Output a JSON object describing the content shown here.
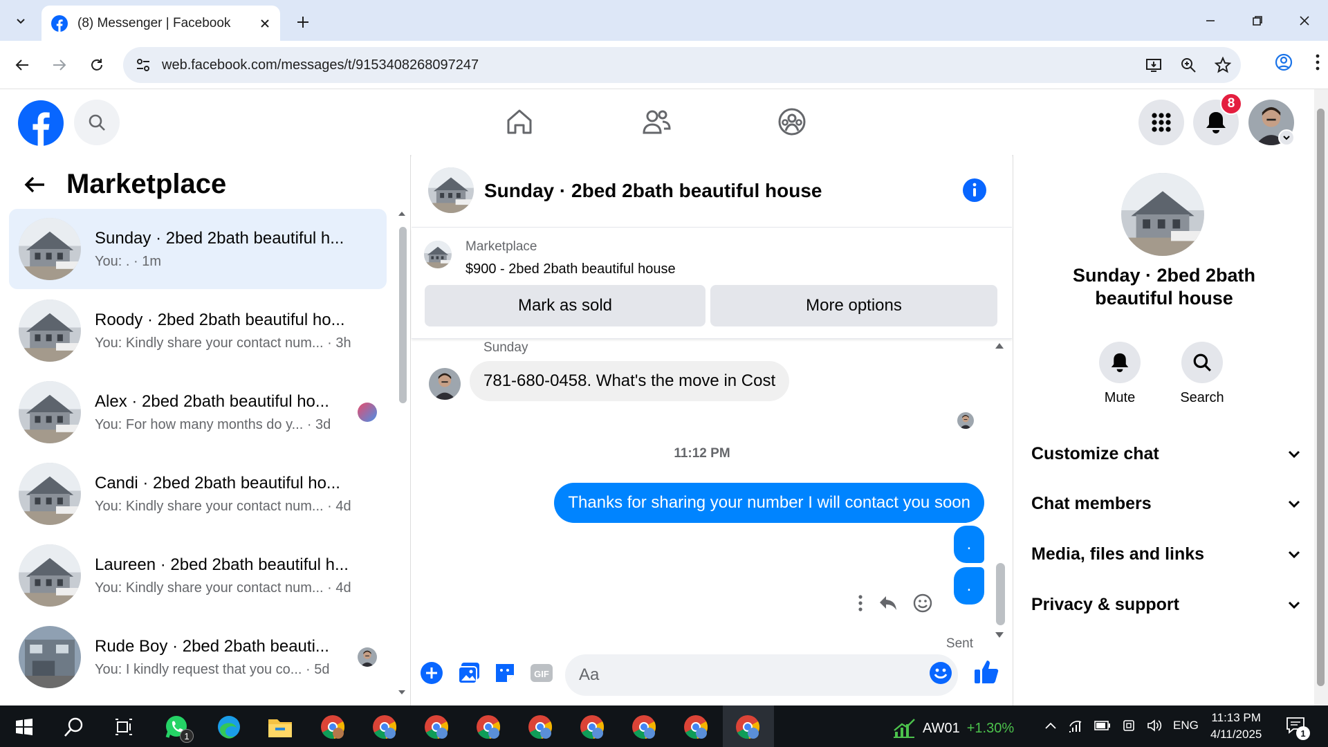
{
  "browser": {
    "tab_title": "(8) Messenger | Facebook",
    "url": "web.facebook.com/messages/t/9153408268097247"
  },
  "header": {
    "notification_count": "8"
  },
  "marketplace": {
    "title": "Marketplace",
    "conversations": [
      {
        "name": "Sunday · 2bed 2bath beautiful h...",
        "preview": "You: . · 1m",
        "active": true
      },
      {
        "name": "Roody · 2bed 2bath beautiful ho...",
        "preview": "You: Kindly share your contact num... · 3h"
      },
      {
        "name": "Alex · 2bed 2bath beautiful ho...",
        "preview": "You: For how many months do y... · 3d"
      },
      {
        "name": "Candi · 2bed 2bath beautiful ho...",
        "preview": "You: Kindly share your contact num... · 4d"
      },
      {
        "name": "Laureen · 2bed 2bath beautiful h...",
        "preview": "You: Kindly share your contact num... · 4d"
      },
      {
        "name": "Rude Boy · 2bed 2bath beauti...",
        "preview": "You: I kindly request that you co... · 5d"
      }
    ]
  },
  "chat": {
    "title": "Sunday · 2bed 2bath beautiful house",
    "listing_label": "Marketplace",
    "listing_price": "$900 - 2bed 2bath beautiful house",
    "mark_sold_label": "Mark as sold",
    "more_options_label": "More options",
    "sender_name": "Sunday",
    "incoming_message": "781-680-0458.  What's the move in Cost",
    "timestamp": "11:12 PM",
    "outgoing_message": "Thanks for sharing your number I will contact you soon",
    "outgoing_dot_1": ".",
    "outgoing_dot_2": ".",
    "sent_status": "Sent",
    "composer_placeholder": "Aa"
  },
  "details": {
    "title": "Sunday · 2bed 2bath beautiful house",
    "mute_label": "Mute",
    "search_label": "Search",
    "sections": [
      "Customize chat",
      "Chat members",
      "Media, files and links",
      "Privacy & support"
    ]
  },
  "taskbar": {
    "whatsapp_badge": "1",
    "stock_name": "AW01",
    "stock_change": "+1.30%",
    "language": "ENG",
    "time": "11:13 PM",
    "date": "4/11/2025",
    "notification_count": "1"
  },
  "colors": {
    "facebook_blue": "#0866ff",
    "messenger_blue": "#0084ff",
    "active_conversation": "#e7f0fc",
    "badge_red": "#e41e3f"
  }
}
